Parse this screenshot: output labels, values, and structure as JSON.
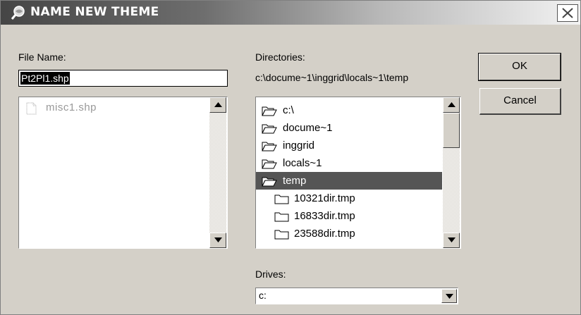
{
  "dialog": {
    "title": "NAME NEW THEME",
    "title_icon": "magnifier-globe-icon",
    "close_icon": "close-icon"
  },
  "file_name": {
    "label": "File Name:",
    "value": "Pt2Pl1.shp",
    "files": [
      {
        "name": "misc1.shp",
        "icon": "shapefile-icon",
        "dimmed": true
      }
    ]
  },
  "directories": {
    "label": "Directories:",
    "current_path": "c:\\docume~1\\inggrid\\locals~1\\temp",
    "items": [
      {
        "name": "c:\\",
        "icon": "open-folder-icon",
        "selected": false,
        "level": 0
      },
      {
        "name": "docume~1",
        "icon": "open-folder-icon",
        "selected": false,
        "level": 0
      },
      {
        "name": "inggrid",
        "icon": "open-folder-icon",
        "selected": false,
        "level": 0
      },
      {
        "name": "locals~1",
        "icon": "open-folder-icon",
        "selected": false,
        "level": 0
      },
      {
        "name": "temp",
        "icon": "open-folder-icon",
        "selected": true,
        "level": 0
      },
      {
        "name": "10321dir.tmp",
        "icon": "closed-folder-icon",
        "selected": false,
        "level": 1
      },
      {
        "name": "16833dir.tmp",
        "icon": "closed-folder-icon",
        "selected": false,
        "level": 1
      },
      {
        "name": "23588dir.tmp",
        "icon": "closed-folder-icon",
        "selected": false,
        "level": 1
      }
    ]
  },
  "drives": {
    "label": "Drives:",
    "selected": "c:"
  },
  "buttons": {
    "ok": "OK",
    "cancel": "Cancel"
  },
  "colors": {
    "dialog_bg": "#d4d0c8",
    "selection_bg": "#555555",
    "selection_fg": "#ffffff"
  }
}
